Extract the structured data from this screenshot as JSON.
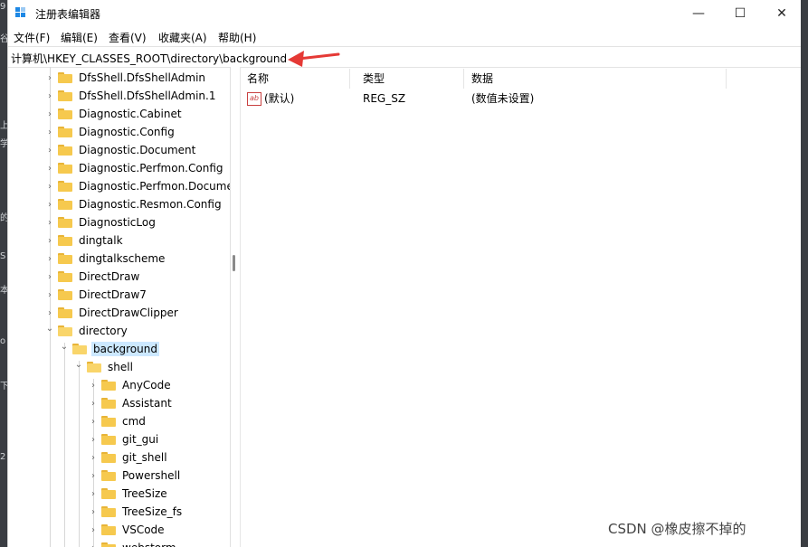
{
  "window": {
    "title": "注册表编辑器",
    "controls": {
      "minimize": "—",
      "maximize": "☐",
      "close": "✕"
    }
  },
  "menu": [
    "文件(F)",
    "编辑(E)",
    "查看(V)",
    "收藏夹(A)",
    "帮助(H)"
  ],
  "address": "计算机\\HKEY_CLASSES_ROOT\\directory\\background",
  "tree": [
    {
      "label": "DfsShell.DfsShellAdmin",
      "expanded": false
    },
    {
      "label": "DfsShell.DfsShellAdmin.1",
      "expanded": false
    },
    {
      "label": "Diagnostic.Cabinet",
      "expanded": false
    },
    {
      "label": "Diagnostic.Config",
      "expanded": false
    },
    {
      "label": "Diagnostic.Document",
      "expanded": false
    },
    {
      "label": "Diagnostic.Perfmon.Config",
      "expanded": false
    },
    {
      "label": "Diagnostic.Perfmon.Docume",
      "expanded": false
    },
    {
      "label": "Diagnostic.Resmon.Config",
      "expanded": false
    },
    {
      "label": "DiagnosticLog",
      "expanded": false
    },
    {
      "label": "dingtalk",
      "expanded": false
    },
    {
      "label": "dingtalkscheme",
      "expanded": false
    },
    {
      "label": "DirectDraw",
      "expanded": false
    },
    {
      "label": "DirectDraw7",
      "expanded": false
    },
    {
      "label": "DirectDrawClipper",
      "expanded": false
    },
    {
      "label": "directory",
      "expanded": true
    },
    {
      "label": "background",
      "expanded": true,
      "selected": true
    },
    {
      "label": "shell",
      "expanded": true
    },
    {
      "label": "AnyCode",
      "expanded": false
    },
    {
      "label": "Assistant",
      "expanded": false
    },
    {
      "label": "cmd",
      "expanded": false
    },
    {
      "label": "git_gui",
      "expanded": false
    },
    {
      "label": "git_shell",
      "expanded": false
    },
    {
      "label": "Powershell",
      "expanded": false
    },
    {
      "label": "TreeSize",
      "expanded": false
    },
    {
      "label": "TreeSize_fs",
      "expanded": false
    },
    {
      "label": "VSCode",
      "expanded": false
    },
    {
      "label": "webstorm",
      "expanded": false
    }
  ],
  "columns": {
    "name": "名称",
    "type": "类型",
    "data": "数据"
  },
  "values": [
    {
      "icon": "ab",
      "name": "(默认)",
      "type": "REG_SZ",
      "data": "(数值未设置)"
    }
  ],
  "watermark": "CSDN @橡皮擦不掉的",
  "background_text": [
    "9",
    "谷",
    "上",
    "学",
    "的",
    "S",
    "本",
    "o",
    "下",
    "2"
  ],
  "colors": {
    "selection": "#cce8ff",
    "folder": "#f6c94e",
    "arrow": "#e53935"
  }
}
